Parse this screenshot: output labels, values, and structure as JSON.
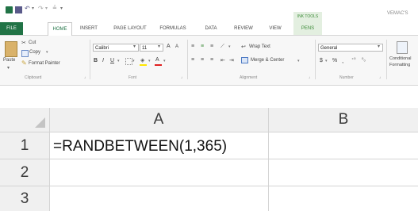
{
  "title_bar": {
    "ink_tools_label": "INK TOOLS",
    "right_text": "VEMAC'S"
  },
  "tabs": [
    "FILE",
    "HOME",
    "INSERT",
    "PAGE LAYOUT",
    "FORMULAS",
    "DATA",
    "REVIEW",
    "VIEW",
    "PENS"
  ],
  "ribbon": {
    "clipboard": {
      "paste": "Paste",
      "cut": "Cut",
      "copy": "Copy",
      "format_painter": "Format Painter",
      "group_label": "Clipboard"
    },
    "font": {
      "font_name": "Calibri",
      "font_size": "11",
      "bold": "B",
      "italic": "I",
      "underline": "U",
      "grow": "A",
      "shrink": "A",
      "font_color": "A",
      "group_label": "Font"
    },
    "alignment": {
      "wrap_text": "Wrap Text",
      "merge_center": "Merge & Center",
      "group_label": "Alignment"
    },
    "number": {
      "format": "General",
      "currency": "$",
      "percent": "%",
      "comma": ",",
      "group_label": "Number"
    },
    "styles": {
      "conditional_line1": "Conditional",
      "conditional_line2": "Formatting"
    }
  },
  "sheet": {
    "columns": [
      "A",
      "B"
    ],
    "rows": [
      "1",
      "2",
      "3"
    ],
    "a1": "=RANDBETWEEN(1,365)"
  },
  "colors": {
    "accent": "#217346",
    "ink_tools": "#3e8c3a",
    "ink_tools_bg": "#e3efe0",
    "header_bg": "#f0f0f0"
  }
}
